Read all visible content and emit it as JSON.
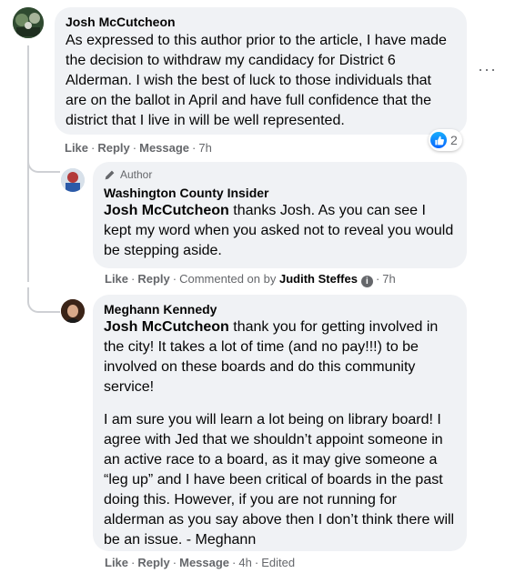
{
  "comments": [
    {
      "name": "Josh McCutcheon",
      "text": "As expressed to this author prior to the article, I have made the decision to withdraw my candidacy for District 6 Alderman. I wish the best of luck to those individuals that are on the ballot in April and have full confidence that the district that I live in will be well represented.",
      "actions": {
        "like": "Like",
        "reply": "Reply",
        "message": "Message",
        "time": "7h"
      },
      "reactions": {
        "count": "2",
        "icon": "like-icon",
        "color": "#0866ff"
      },
      "more_label": "···"
    }
  ],
  "replies": [
    {
      "badge": "Author",
      "badge_icon": "pencil-icon",
      "name": "Washington County Insider",
      "mention": "Josh McCutcheon",
      "text": " thanks Josh. As you can see I kept my word when you asked not to reveal you would be stepping aside.",
      "actions": {
        "like": "Like",
        "reply": "Reply",
        "commented_on": "Commented on by",
        "commenter": "Judith Steffes",
        "info_icon": "info-icon",
        "time": "7h"
      }
    },
    {
      "name": "Meghann Kennedy",
      "mention": "Josh McCutcheon",
      "text": " thank you for getting involved in the city! It takes a lot of time (and no pay!!!) to be involved on these boards and do this community service!",
      "text2": "I am sure you will learn a lot being on library board! I agree with Jed that we shouldn’t appoint someone in an active race to a board, as it may give someone a “leg up” and I have been critical of boards in the past doing this. However, if you are not running for alderman as you say above then I don’t think there will be an issue. - Meghann",
      "actions": {
        "like": "Like",
        "reply": "Reply",
        "message": "Message",
        "time": "4h",
        "edited": "Edited"
      }
    }
  ]
}
